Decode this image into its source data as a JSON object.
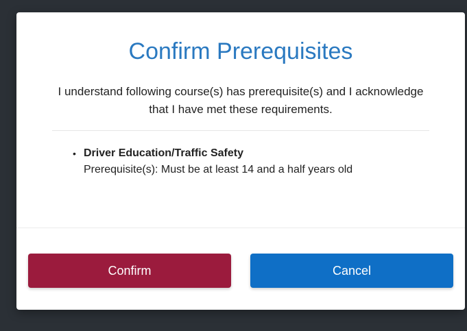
{
  "modal": {
    "title": "Confirm Prerequisites",
    "message": "I understand following course(s) has prerequisite(s) and I acknowledge that I have met these requirements.",
    "courses": [
      {
        "name": "Driver Education/Traffic Safety",
        "prerequisite": "Prerequisite(s): Must be at least 14 and a half years old"
      }
    ],
    "bullet": "•",
    "confirm_label": "Confirm",
    "cancel_label": "Cancel"
  },
  "colors": {
    "title": "#2a79c0",
    "confirm": "#9b1b3d",
    "cancel": "#0f6fc6",
    "backdrop": "#2b3036"
  }
}
